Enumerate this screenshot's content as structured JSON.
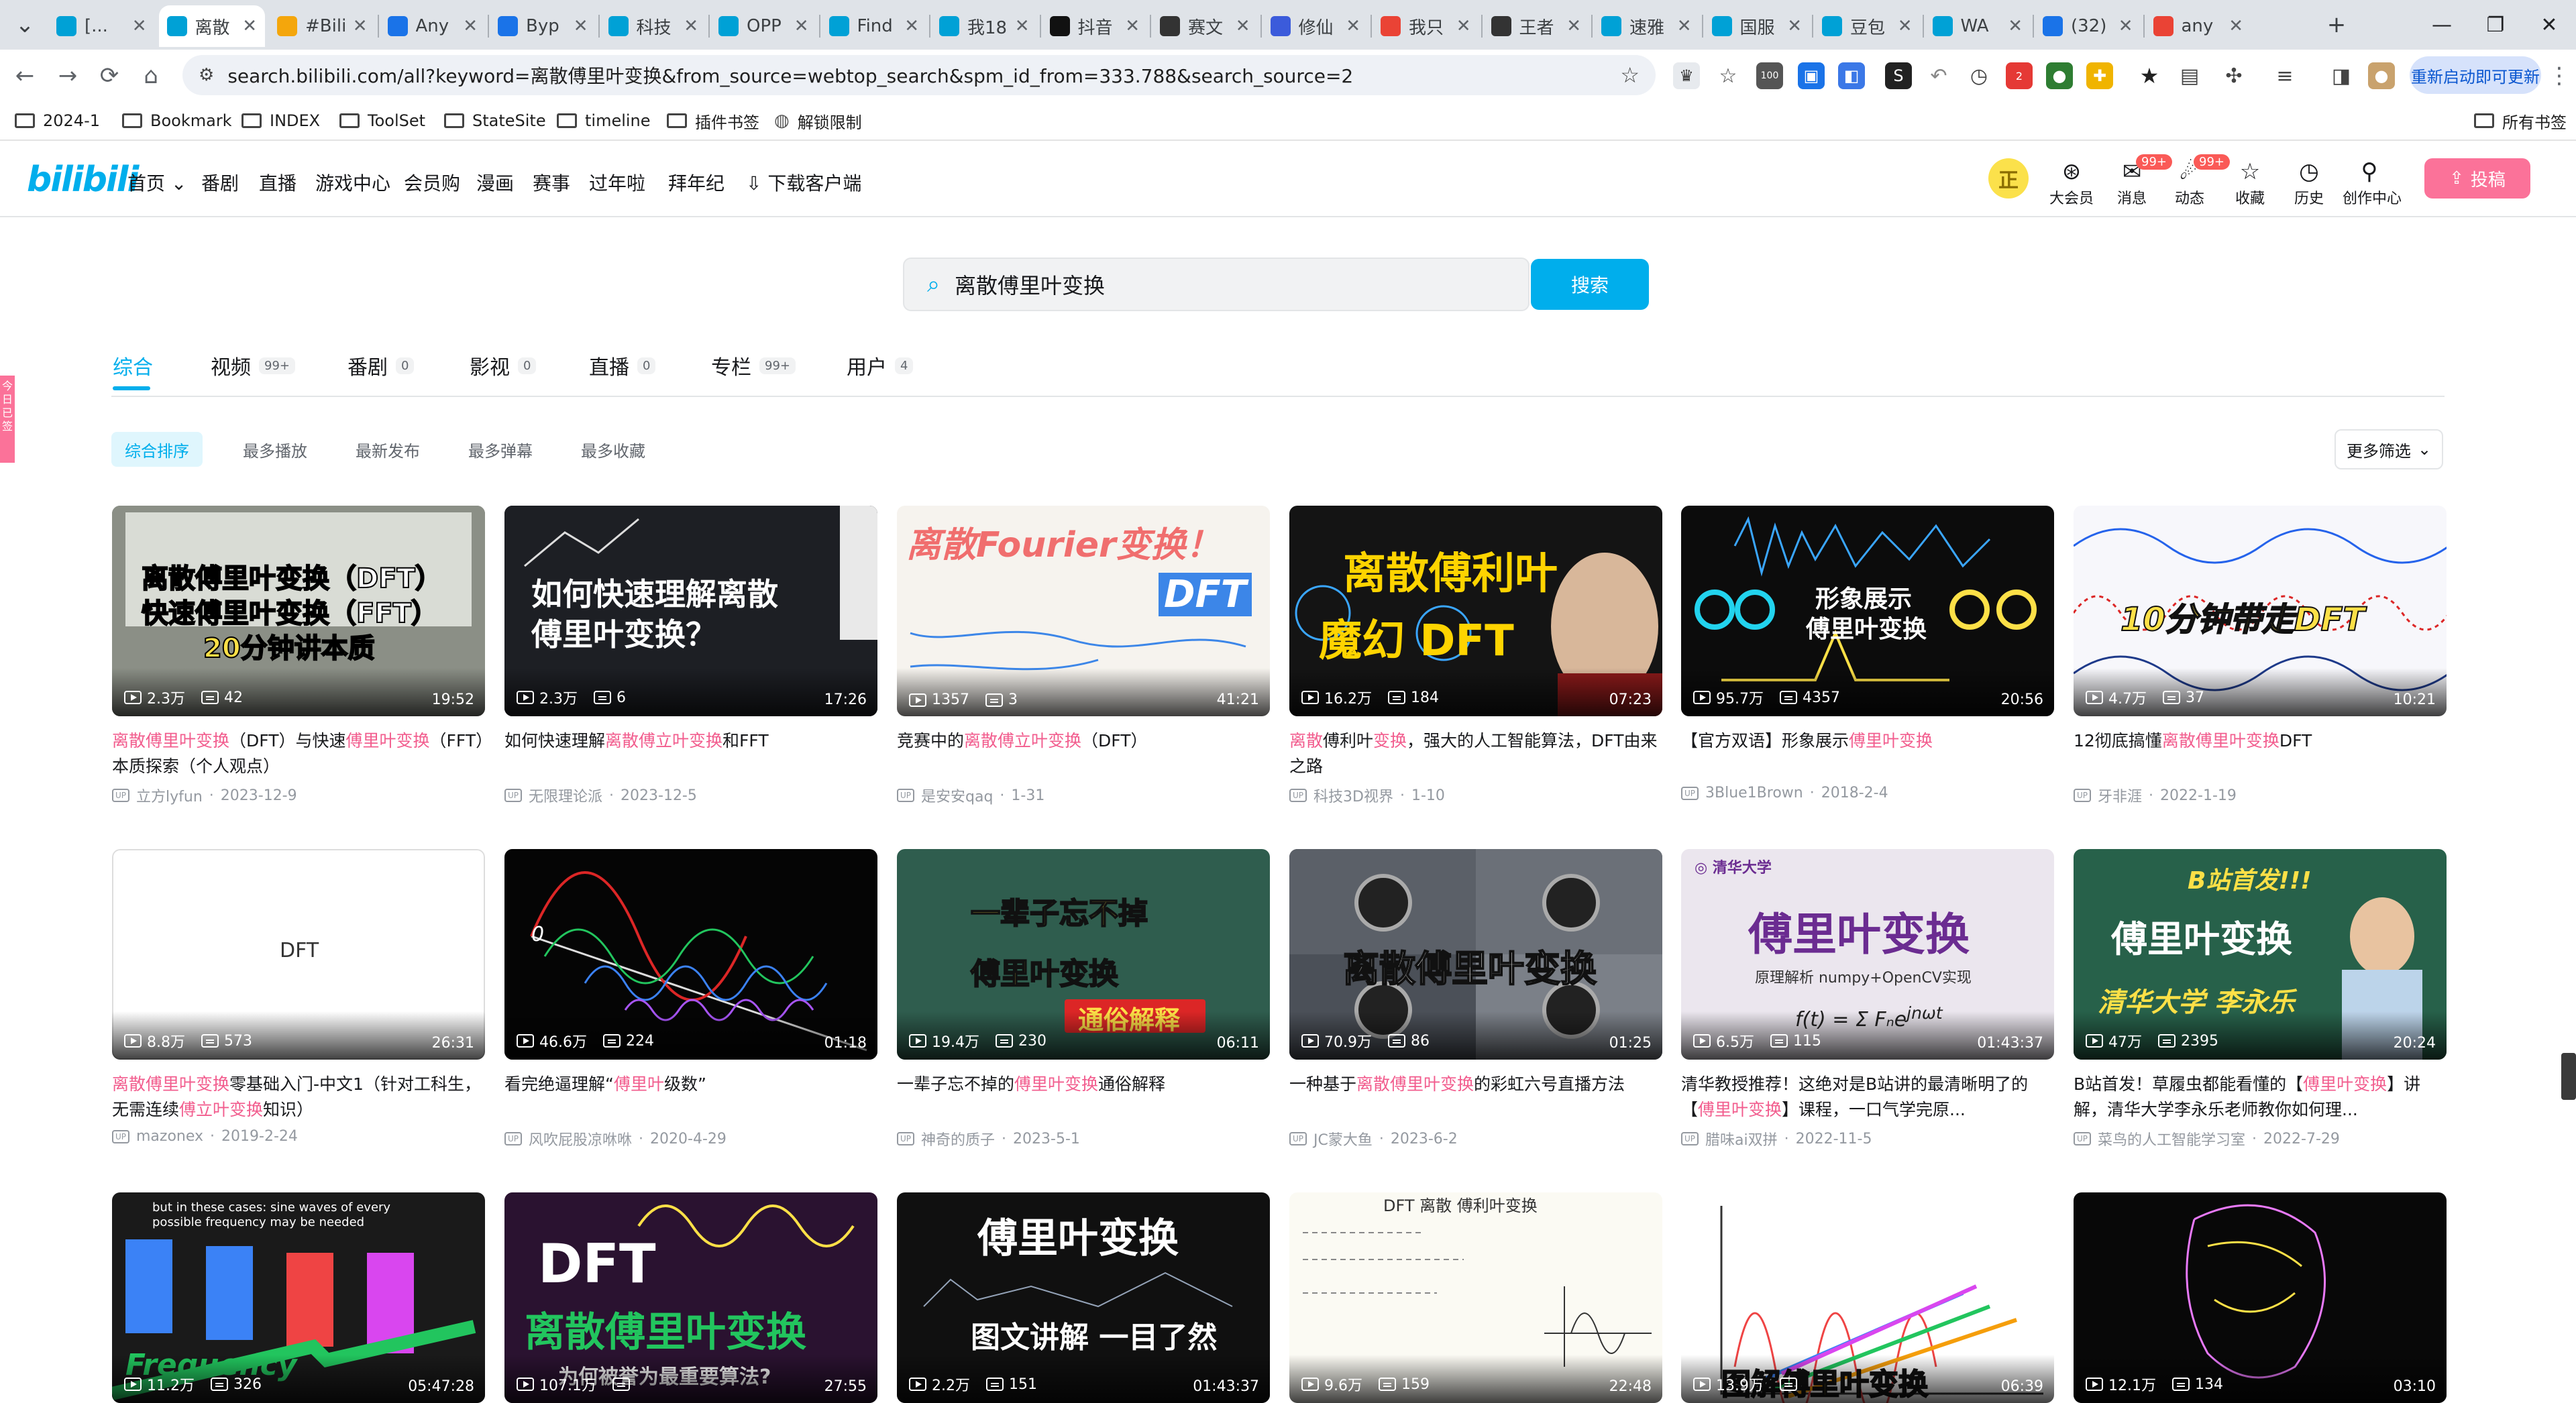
{
  "browser": {
    "tabs": [
      {
        "title": "[...",
        "color": "#00a1d6"
      },
      {
        "title": "离散",
        "color": "#00a1d6",
        "active": true
      },
      {
        "title": "#Bili",
        "color": "#f4a60c"
      },
      {
        "title": "Any",
        "color": "#1a73e8"
      },
      {
        "title": "Byp",
        "color": "#1a73e8"
      },
      {
        "title": "科技",
        "color": "#00a1d6"
      },
      {
        "title": "OPP",
        "color": "#00a1d6"
      },
      {
        "title": "Find",
        "color": "#00a1d6"
      },
      {
        "title": "我18",
        "color": "#00a1d6"
      },
      {
        "title": "抖音",
        "color": "#111111"
      },
      {
        "title": "赛文",
        "color": "#333333"
      },
      {
        "title": "修仙",
        "color": "#3b5bdb"
      },
      {
        "title": "我只",
        "color": "#ea4335"
      },
      {
        "title": "王者",
        "color": "#333333"
      },
      {
        "title": "速雅",
        "color": "#00a1d6"
      },
      {
        "title": "国服",
        "color": "#00a1d6"
      },
      {
        "title": "豆包",
        "color": "#00a1d6"
      },
      {
        "title": "WA",
        "color": "#00a1d6"
      },
      {
        "title": "(32)",
        "color": "#1a73e8"
      },
      {
        "title": "any",
        "color": "#ea4335"
      }
    ],
    "url": "search.bilibili.com/all?keyword=离散傅里叶变换&from_source=webtop_search&spm_id_from=333.788&search_source=2",
    "update_button": "重新启动即可更新",
    "ext_badges": {
      "ext3": "100",
      "ext12": "2"
    },
    "bookmarks": [
      "2024-1",
      "Bookmark",
      "INDEX",
      "ToolSet",
      "StateSite",
      "timeline",
      "插件书签",
      "解锁限制"
    ],
    "all_bookmarks": "所有书签"
  },
  "site": {
    "logo": "bilibili",
    "nav": [
      "首页",
      "番剧",
      "直播",
      "游戏中心",
      "会员购",
      "漫画",
      "赛事",
      "过年啦",
      "拜年纪",
      "下载客户端"
    ],
    "avatar_text": "正",
    "header_entries": [
      {
        "label": "大会员",
        "badge": ""
      },
      {
        "label": "消息",
        "badge": "99+"
      },
      {
        "label": "动态",
        "badge": "99+"
      },
      {
        "label": "收藏",
        "badge": ""
      },
      {
        "label": "历史",
        "badge": ""
      },
      {
        "label": "创作中心",
        "badge": ""
      }
    ],
    "upload": "投稿",
    "side_tag": "今日已签"
  },
  "search": {
    "query": "离散傅里叶变换",
    "button": "搜索"
  },
  "tabs": [
    {
      "label": "综合",
      "count": ""
    },
    {
      "label": "视频",
      "count": "99+"
    },
    {
      "label": "番剧",
      "count": "0"
    },
    {
      "label": "影视",
      "count": "0"
    },
    {
      "label": "直播",
      "count": "0"
    },
    {
      "label": "专栏",
      "count": "99+"
    },
    {
      "label": "用户",
      "count": "4"
    }
  ],
  "filters": [
    "综合排序",
    "最多播放",
    "最新发布",
    "最多弹幕",
    "最多收藏"
  ],
  "more_filter": "更多筛选",
  "videos": [
    {
      "overlay": "离散傅里叶变换（DFT）\n快速傅里叶变换（FFT）\n20分钟讲本质",
      "views": "2.3万",
      "danmaku": "42",
      "duration": "19:52",
      "title": [
        [
          "离散傅里叶变换",
          1
        ],
        [
          "（DFT）与快速",
          0
        ],
        [
          "傅里叶变换",
          1
        ],
        [
          "（FFT）本质探索（个人观点）",
          0
        ]
      ],
      "author": "立方lyfun",
      "date": "2023-12-9",
      "bg": "#6b6f6a"
    },
    {
      "overlay": "如何快速理解离散\n傅里叶变换？",
      "views": "2.3万",
      "danmaku": "6",
      "duration": "17:26",
      "title": [
        [
          "如何快速理解",
          0
        ],
        [
          "离散傅立叶变换",
          1
        ],
        [
          "和FFT",
          0
        ]
      ],
      "author": "无限理论派",
      "date": "2023-12-5",
      "bg": "#1d1f24"
    },
    {
      "overlay": "离散Fourier变换！",
      "views": "1357",
      "danmaku": "3",
      "duration": "41:21",
      "title": [
        [
          "竞赛中的",
          0
        ],
        [
          "离散傅立叶变换",
          1
        ],
        [
          "（DFT）",
          0
        ]
      ],
      "author": "是安安qaq",
      "date": "1-31",
      "bg": "#f6f3ee"
    },
    {
      "overlay": "离散傅利叶\n魔幻 DFT",
      "views": "16.2万",
      "danmaku": "184",
      "duration": "07:23",
      "title": [
        [
          "离散",
          1
        ],
        [
          "傅利叶",
          0
        ],
        [
          "变换",
          1
        ],
        [
          "，强大的人工智能算法，DFT由来之路",
          0
        ]
      ],
      "author": "科技3D视界",
      "date": "1-10",
      "bg": "#141414"
    },
    {
      "overlay": "形象展示\n傅里叶变换",
      "views": "95.7万",
      "danmaku": "4357",
      "duration": "20:56",
      "title": [
        [
          "【官方双语】形象展示",
          0
        ],
        [
          "傅里叶变换",
          1
        ]
      ],
      "author": "3Blue1Brown",
      "date": "2018-2-4",
      "bg": "#0c0c0c"
    },
    {
      "overlay": "10分钟带走DFT",
      "views": "4.7万",
      "danmaku": "37",
      "duration": "10:21",
      "title": [
        [
          "12彻底搞懂",
          0
        ],
        [
          "离散傅里叶变换",
          1
        ],
        [
          "DFT",
          0
        ]
      ],
      "author": "牙非涯",
      "date": "2022-1-19",
      "bg": "#f7f7fb"
    },
    {
      "overlay": "DFT",
      "views": "8.8万",
      "danmaku": "573",
      "duration": "26:31",
      "title": [
        [
          "离散傅里叶变换",
          1
        ],
        [
          "零基础入门-中文1（针对工科生，无需连续",
          0
        ],
        [
          "傅立叶变换",
          1
        ],
        [
          "知识）",
          0
        ]
      ],
      "author": "mazonex",
      "date": "2019-2-24",
      "bg": "#ffffff"
    },
    {
      "overlay": "0",
      "views": "46.6万",
      "danmaku": "224",
      "duration": "01:18",
      "title": [
        [
          "看完绝逼理解“",
          0
        ],
        [
          "傅里叶",
          1
        ],
        [
          "级数”",
          0
        ]
      ],
      "author": "风吹屁股凉咻咻",
      "date": "2020-4-29",
      "bg": "#050505"
    },
    {
      "overlay": "一辈子忘不掉\n傅里叶变换\n通俗解释",
      "views": "19.4万",
      "danmaku": "230",
      "duration": "06:11",
      "title": [
        [
          "一辈子忘不掉的",
          0
        ],
        [
          "傅里叶变换",
          1
        ],
        [
          "通俗解释",
          0
        ]
      ],
      "author": "神奇的质子",
      "date": "2023-5-1",
      "bg": "#2f5d4e"
    },
    {
      "overlay": "离散傅里叶变换",
      "views": "70.9万",
      "danmaku": "86",
      "duration": "01:25",
      "title": [
        [
          "一种基于",
          0
        ],
        [
          "离散傅里叶变换",
          1
        ],
        [
          "的彩虹六号直播方法",
          0
        ]
      ],
      "author": "JC蒙大鱼",
      "date": "2023-6-2",
      "bg": "#3c4046"
    },
    {
      "overlay": "傅里叶变换\n原理解析 numpy+OpenCV实现",
      "views": "6.5万",
      "danmaku": "115",
      "duration": "01:43:37",
      "title": [
        [
          "清华教授推荐！这绝对是B站讲的最清晰明了的【",
          0
        ],
        [
          "傅里叶变换",
          1
        ],
        [
          "】课程，一口气学完原...",
          0
        ]
      ],
      "author": "腊味ai双拼",
      "date": "2022-11-5",
      "bg": "#ebe6ee"
    },
    {
      "overlay": "B站首发!!!\n傅里叶变换\n清华大学 李永乐",
      "views": "47万",
      "danmaku": "2395",
      "duration": "20:24",
      "title": [
        [
          "B站首发！草履虫都能看懂的【",
          0
        ],
        [
          "傅里叶变换",
          1
        ],
        [
          "】讲解，清华大学李永乐老师教你如何理...",
          0
        ]
      ],
      "author": "菜鸟的人工智能学习室",
      "date": "2022-7-29",
      "bg": "#27614a"
    },
    {
      "overlay": "Frequency",
      "views": "11.2万",
      "danmaku": "326",
      "duration": "05:47:28",
      "title": [],
      "author": "",
      "date": "",
      "bg": "#1a1a1a"
    },
    {
      "overlay": "DFT\n离散傅里叶变换\n为何被誉为最重要算法?",
      "views": "107.1万",
      "danmaku": "",
      "duration": "27:55",
      "title": [],
      "author": "",
      "date": "",
      "bg": "#2a1230"
    },
    {
      "overlay": "傅里叶变换\n图文讲解 一目了然",
      "views": "2.2万",
      "danmaku": "151",
      "duration": "01:43:37",
      "title": [],
      "author": "",
      "date": "",
      "bg": "#101010"
    },
    {
      "overlay": "DFT 离散 傅利叶变换",
      "views": "9.6万",
      "danmaku": "159",
      "duration": "22:48",
      "title": [],
      "author": "",
      "date": "",
      "bg": "#fbfaf3"
    },
    {
      "overlay": "图解傅里叶变换",
      "views": "13.9万",
      "danmaku": "",
      "duration": "06:39",
      "title": [],
      "author": "",
      "date": "",
      "bg": "#ffffff"
    },
    {
      "overlay": "",
      "views": "12.1万",
      "danmaku": "134",
      "duration": "03:10",
      "title": [],
      "author": "",
      "date": "",
      "bg": "#080808"
    }
  ]
}
